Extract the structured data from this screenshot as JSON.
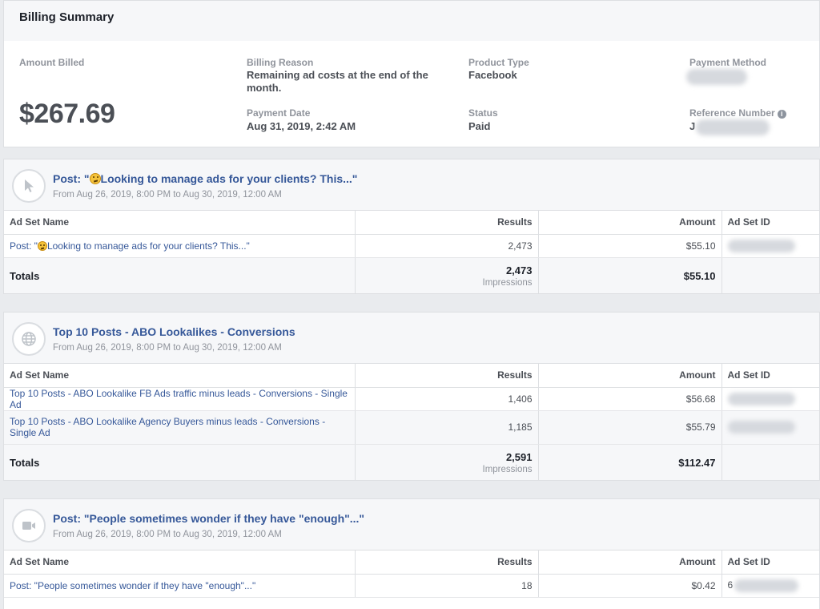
{
  "summary": {
    "title": "Billing Summary",
    "amount_billed_label": "Amount Billed",
    "amount_billed": "$267.69",
    "billing_reason_label": "Billing Reason",
    "billing_reason": "Remaining ad costs at the end of the month.",
    "payment_date_label": "Payment Date",
    "payment_date": "Aug 31, 2019, 2:42 AM",
    "product_type_label": "Product Type",
    "product_type": "Facebook",
    "status_label": "Status",
    "status": "Paid",
    "payment_method_label": "Payment Method",
    "reference_number_label": "Reference Number",
    "reference_prefix": "J"
  },
  "columns": {
    "name": "Ad Set Name",
    "results": "Results",
    "amount": "Amount",
    "id": "Ad Set ID"
  },
  "totals_label": "Totals",
  "campaigns": [
    {
      "icon": "cursor-icon",
      "title_pre": "Post: \"",
      "title_post": "Looking to manage ads for your clients? This...\"",
      "date_range": "From Aug 26, 2019, 8:00 PM to Aug 30, 2019, 12:00 AM",
      "rows": [
        {
          "name_pre": "Post: \"",
          "name_post": "Looking to manage ads for your clients? This...\"",
          "results": "2,473",
          "amount": "$55.10"
        }
      ],
      "totals": {
        "results": "2,473",
        "unit": "Impressions",
        "amount": "$55.10"
      }
    },
    {
      "icon": "globe-icon",
      "title": "Top 10 Posts - ABO Lookalikes - Conversions",
      "date_range": "From Aug 26, 2019, 8:00 PM to Aug 30, 2019, 12:00 AM",
      "rows": [
        {
          "name": "Top 10 Posts - ABO Lookalike FB Ads traffic minus leads - Conversions - Single Ad",
          "results": "1,406",
          "amount": "$56.68"
        },
        {
          "name": "Top 10 Posts - ABO Lookalike Agency Buyers minus leads - Conversions - Single Ad",
          "results": "1,185",
          "amount": "$55.79"
        }
      ],
      "totals": {
        "results": "2,591",
        "unit": "Impressions",
        "amount": "$112.47"
      }
    },
    {
      "icon": "video-icon",
      "title": "Post: \"People sometimes wonder if they have \"enough\"...\"",
      "date_range": "From Aug 26, 2019, 8:00 PM to Aug 30, 2019, 12:00 AM",
      "rows": [
        {
          "name": "Post: \"People sometimes wonder if they have \"enough\"...\"",
          "results": "18",
          "amount": "$0.42",
          "id_prefix": "6"
        }
      ]
    }
  ]
}
